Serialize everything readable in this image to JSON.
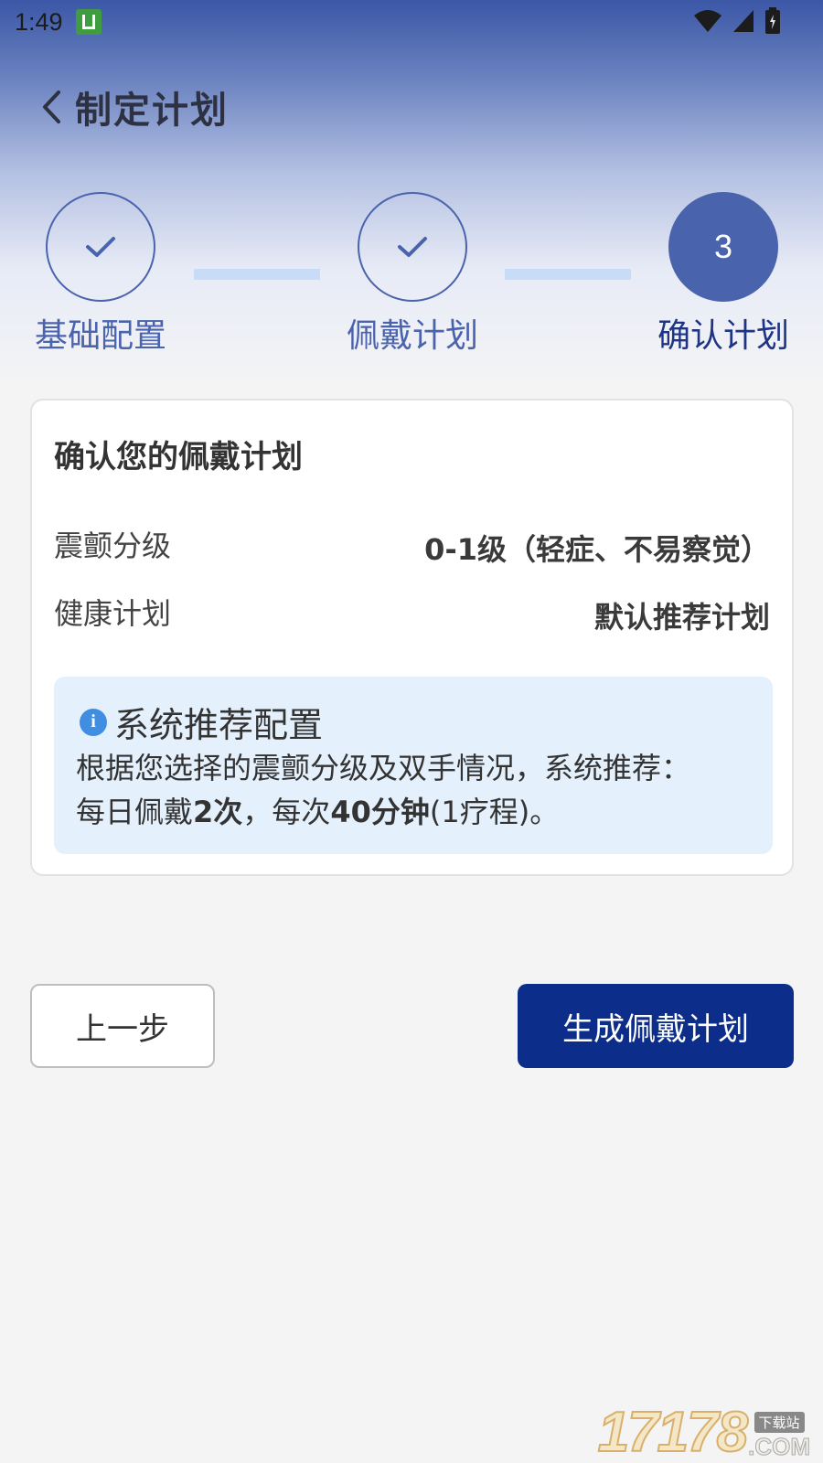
{
  "status_bar": {
    "time": "1:49"
  },
  "header": {
    "title": "制定计划"
  },
  "steps": [
    {
      "label": "基础配置",
      "number": "",
      "state": "done"
    },
    {
      "label": "佩戴计划",
      "number": "",
      "state": "done"
    },
    {
      "label": "确认计划",
      "number": "3",
      "state": "active"
    }
  ],
  "card": {
    "title": "确认您的佩戴计划",
    "rows": [
      {
        "label": "震颤分级",
        "value": "0-1级（轻症、不易察觉）"
      },
      {
        "label": "健康计划",
        "value": "默认推荐计划"
      }
    ],
    "info": {
      "title": "系统推荐配置",
      "line1": "根据您选择的震颤分级及双手情况，系统推荐：",
      "line2_prefix": "每日佩戴",
      "times": "2次",
      "line2_mid": "，每次",
      "duration": "40分钟",
      "line2_suffix": "(1疗程)。"
    }
  },
  "buttons": {
    "prev": "上一步",
    "generate": "生成佩戴计划"
  },
  "watermark": {
    "digits": "17178",
    "tag": "下载站",
    "com": ".COM"
  },
  "colors": {
    "primary": "#0d2d8a",
    "step_accent": "#4a63ad",
    "connector": "#c8dcf8",
    "info_bg": "#e4f0fc"
  }
}
